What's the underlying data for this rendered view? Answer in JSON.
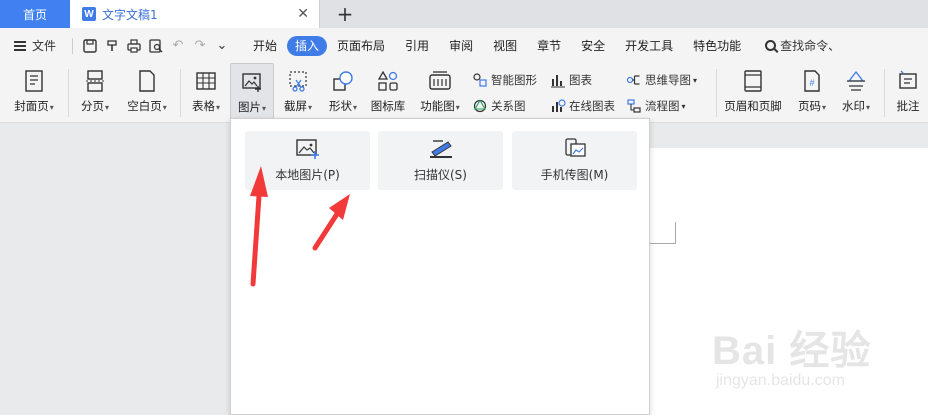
{
  "tabs": {
    "home": "首页",
    "doc_logo": "W",
    "doc_title": "文字文稿1",
    "close": "✕",
    "add": "+"
  },
  "menubar": {
    "file": "文件",
    "tabs": [
      "开始",
      "插入",
      "页面布局",
      "引用",
      "审阅",
      "视图",
      "章节",
      "安全",
      "开发工具",
      "特色功能"
    ],
    "active_tab": "插入",
    "search": "查找命令、"
  },
  "ribbon": {
    "cover": "封面页",
    "page_break": "分页",
    "blank_page": "空白页",
    "table": "表格",
    "picture": "图片",
    "screenshot": "截屏",
    "shapes": "形状",
    "icon_lib": "图标库",
    "func_chart": "功能图",
    "smart_graphic": "智能图形",
    "chart": "图表",
    "mind_map": "思维导图",
    "relation_chart": "关系图",
    "online_chart": "在线图表",
    "flowchart": "流程图",
    "header_footer": "页眉和页脚",
    "page_number": "页码",
    "watermark": "水印",
    "comment": "批注"
  },
  "dropdown": {
    "local_picture": "本地图片(P)",
    "scanner": "扫描仪(S)",
    "phone_picture": "手机传图(M)"
  },
  "watermark": {
    "main": "Bai 经验",
    "sub": "jingyan.baidu.com"
  },
  "colors": {
    "accent": "#3f7ce8",
    "arrow": "#f23a3a"
  }
}
